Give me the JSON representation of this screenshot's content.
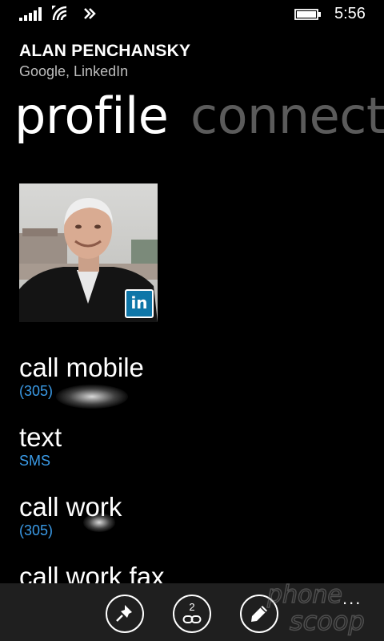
{
  "status_bar": {
    "time": "5:56",
    "icons": [
      "signal-strength-icon",
      "wifi-icon",
      "data-connection-icon",
      "battery-icon"
    ]
  },
  "contact": {
    "name": "ALAN PENCHANSKY",
    "sources": "Google, LinkedIn",
    "avatar_badge": "in"
  },
  "pivot": {
    "active": "profile",
    "next": "connect"
  },
  "actions": [
    {
      "title": "call mobile",
      "subtitle": "(305)"
    },
    {
      "title": "text",
      "subtitle": "SMS"
    },
    {
      "title": "call work",
      "subtitle": "(305)"
    },
    {
      "title": "call work fax",
      "subtitle": ""
    }
  ],
  "app_bar": {
    "buttons": [
      "pin-icon",
      "link-icon",
      "edit-icon"
    ],
    "link_count": "2",
    "more": "..."
  },
  "colors": {
    "accent": "#3a9ae6",
    "background": "#000000",
    "app_bar": "#1f1f1f",
    "linkedin": "#0e76a8"
  }
}
